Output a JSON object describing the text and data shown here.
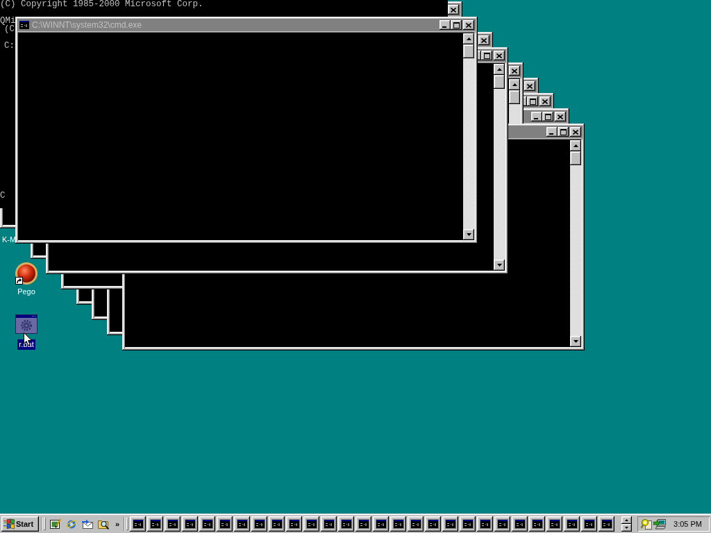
{
  "console_remnant": {
    "lines": [
      "(C) Copyright 1985-2000 Microsoft Corp.",
      "QMi",
      "(C",
      "C:",
      "C"
    ]
  },
  "windows": [
    {
      "active": false
    },
    {
      "title": "C:\\WINNT\\system32\\cmd.exe",
      "active": false
    },
    {
      "active": false
    },
    {
      "active": false
    },
    {
      "active": false
    },
    {
      "active": false
    },
    {
      "active": false
    },
    {
      "active": false
    },
    {
      "active": false
    }
  ],
  "desktop": {
    "icons": [
      {
        "label": "K-M",
        "kind": "covered",
        "selected": false
      },
      {
        "label": "Pego",
        "kind": "shortcut",
        "selected": false
      },
      {
        "label": "r.bat",
        "kind": "batch",
        "selected": true
      }
    ]
  },
  "taskbar": {
    "start_label": "Start",
    "quick_launch_more": "»",
    "window_buttons": [
      {
        "pressed": false
      },
      {
        "pressed": false
      },
      {
        "pressed": false
      },
      {
        "pressed": false
      },
      {
        "pressed": false
      },
      {
        "pressed": false
      },
      {
        "pressed": false
      },
      {
        "pressed": false
      },
      {
        "pressed": false
      },
      {
        "pressed": false
      },
      {
        "pressed": false
      },
      {
        "pressed": false
      },
      {
        "pressed": false
      },
      {
        "pressed": false
      },
      {
        "pressed": false
      },
      {
        "pressed": false
      },
      {
        "pressed": false
      },
      {
        "pressed": false
      },
      {
        "pressed": false
      },
      {
        "pressed": false
      },
      {
        "pressed": false
      },
      {
        "pressed": false
      },
      {
        "pressed": false
      },
      {
        "pressed": false
      },
      {
        "pressed": false
      },
      {
        "pressed": false
      },
      {
        "pressed": false
      },
      {
        "pressed": false
      }
    ],
    "clock": "3:05 PM"
  }
}
